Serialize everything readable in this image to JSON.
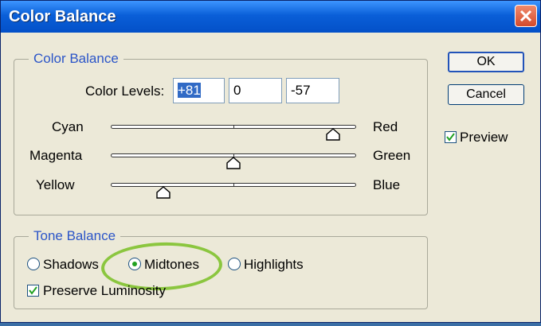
{
  "window": {
    "title": "Color Balance"
  },
  "color_balance": {
    "legend": "Color Balance",
    "levels_label": "Color Levels:",
    "levels": [
      "+81",
      "0",
      "-57"
    ],
    "sliders": [
      {
        "left": "Cyan",
        "right": "Red",
        "value": 81
      },
      {
        "left": "Magenta",
        "right": "Green",
        "value": 0
      },
      {
        "left": "Yellow",
        "right": "Blue",
        "value": -57
      }
    ],
    "slider_range": [
      -100,
      100
    ]
  },
  "tone_balance": {
    "legend": "Tone Balance",
    "options": [
      "Shadows",
      "Midtones",
      "Highlights"
    ],
    "selected": "Midtones",
    "preserve_luminosity_label": "Preserve Luminosity",
    "preserve_luminosity_checked": true
  },
  "buttons": {
    "ok": "OK",
    "cancel": "Cancel"
  },
  "preview": {
    "label": "Preview",
    "checked": true
  },
  "colors": {
    "titlebar": "#0a5fd8",
    "legend_text": "#2b55c8",
    "highlight_ring": "#8bc63f",
    "radio_dot": "#21a121"
  }
}
